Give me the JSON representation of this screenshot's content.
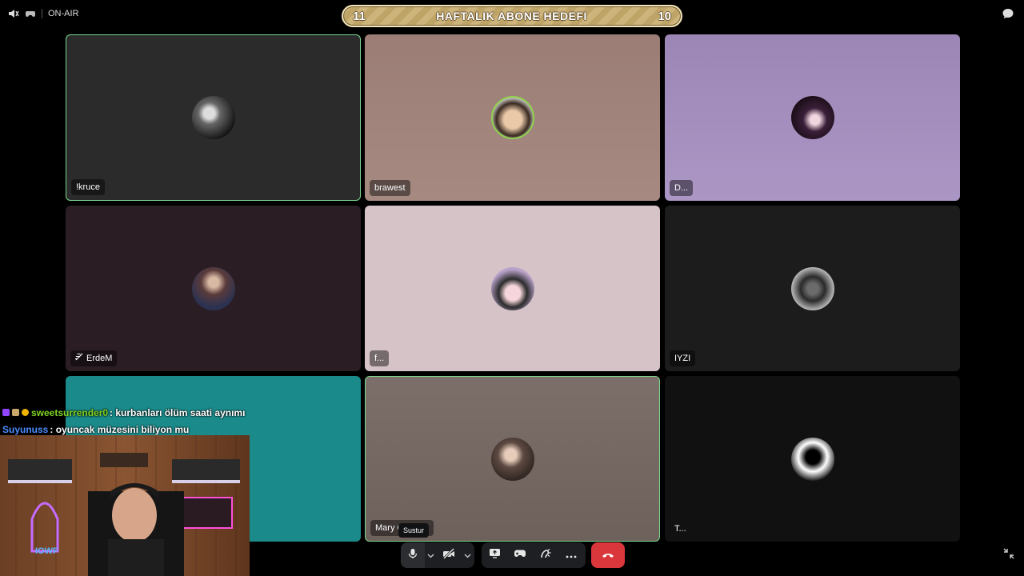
{
  "status": {
    "label": "ON-AIR"
  },
  "goal": {
    "left_number": "11",
    "title": "HAFTALIK ABONE HEDEFI",
    "right_number": "10"
  },
  "tiles": [
    {
      "name": "!kruce",
      "bg": "#2b2b2b"
    },
    {
      "name": "brawest",
      "bg": "#a6857d"
    },
    {
      "name": "D...",
      "bg": "#a792bf"
    },
    {
      "name": "ErdeM",
      "bg": "#2a1d23"
    },
    {
      "name": "f...",
      "bg": "#d6c3c7"
    },
    {
      "name": "IYZI",
      "bg": "#1c1c1c"
    },
    {
      "name": "",
      "bg": "#1a8a8a"
    },
    {
      "name": "Mary C",
      "name_tail": "y",
      "bg": "#7a6c67"
    },
    {
      "name": "T...",
      "bg": "#111111"
    }
  ],
  "chat": [
    {
      "user": "sweetsurrender0",
      "user_color": "#7ed321",
      "message": ": kurbanları ölüm saati aynımı"
    },
    {
      "user": "Suyunuss",
      "user_color": "#4d8dff",
      "message": ": oyuncak müzesini biliyon mu"
    }
  ],
  "tooltip": {
    "text": "Sustur"
  },
  "controls": {
    "mic_icon": "microphone-icon",
    "camera_icon": "camera-off-icon",
    "screen_share_icon": "screen-share-icon",
    "activity_icon": "gamepad-icon",
    "soundboard_icon": "soundboard-icon",
    "more_icon": "more-icon",
    "end_call_icon": "phone-hangup-icon"
  },
  "colors": {
    "end_call": "#da373c",
    "speaking_border": "#7bd88f",
    "controls_bg": "#1e1f22"
  }
}
